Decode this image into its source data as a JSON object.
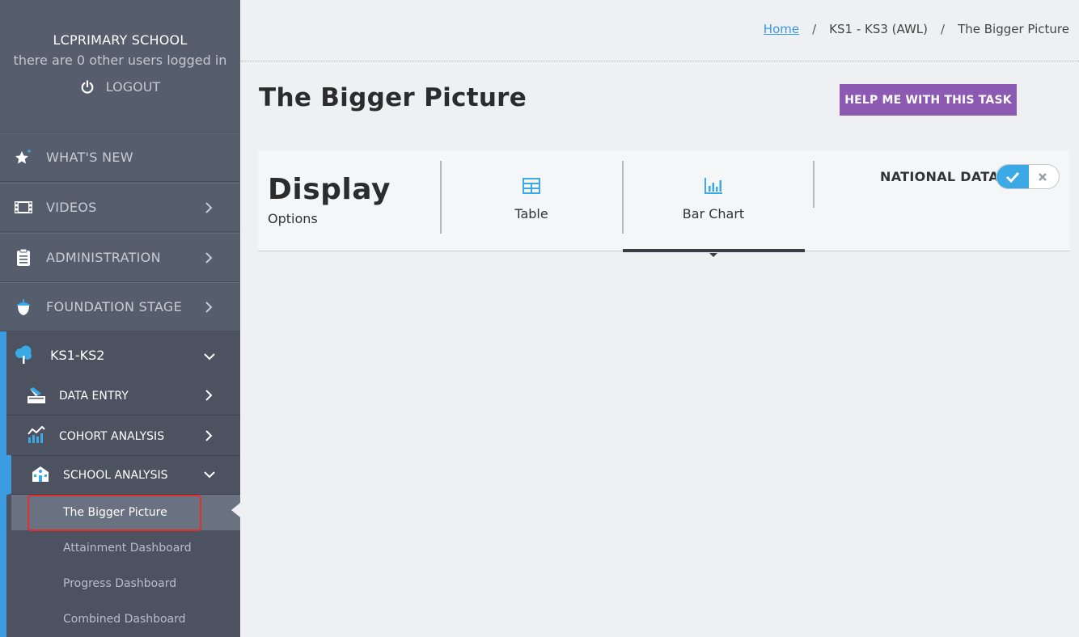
{
  "sidebar": {
    "school_name": "LCPRIMARY SCHOOL",
    "users_text": "there are 0 other users logged in",
    "logout_label": "LOGOUT",
    "nav": {
      "whats_new": "WHAT'S NEW",
      "videos": "VIDEOS",
      "administration": "ADMINISTRATION",
      "foundation_stage": "FOUNDATION STAGE",
      "ks1_ks2": "KS1-KS2"
    },
    "ks12": {
      "data_entry": "DATA ENTRY",
      "cohort_analysis": "COHORT ANALYSIS",
      "school_analysis": "SCHOOL ANALYSIS",
      "links": {
        "bigger_picture": "The Bigger Picture",
        "attainment": "Attainment Dashboard",
        "progress": "Progress Dashboard",
        "combined": "Combined Dashboard"
      }
    }
  },
  "breadcrumb": {
    "home": "Home",
    "sep": "/",
    "section": "KS1 - KS3 (AWL)",
    "current": "The Bigger Picture"
  },
  "page": {
    "title": "The Bigger Picture",
    "help_button": "HELP ME WITH THIS TASK"
  },
  "display": {
    "title": "Display",
    "subtitle": "Options",
    "table_label": "Table",
    "bar_chart_label": "Bar Chart",
    "selected": "Bar Chart"
  },
  "national_data": {
    "label": "NATIONAL DATA",
    "enabled": true
  },
  "colors": {
    "sidebar": "#565d6d",
    "accent_blue": "#3a9be0",
    "help_purple": "#8d5ab3",
    "highlight_red": "#e0302e"
  }
}
